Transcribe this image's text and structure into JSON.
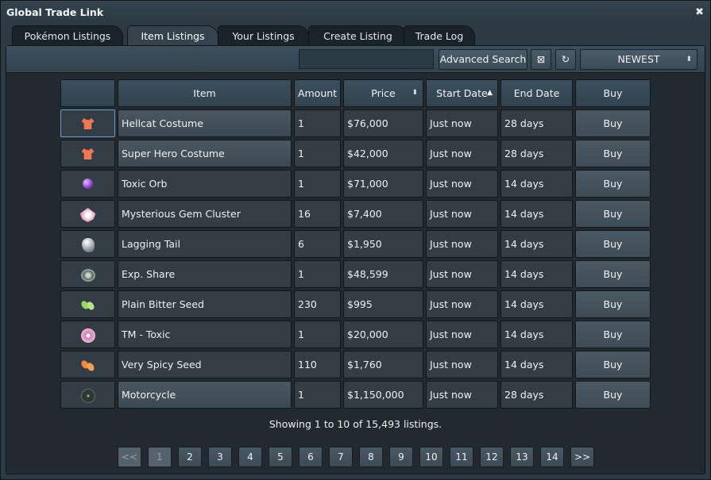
{
  "window": {
    "title": "Global Trade Link"
  },
  "tabs": [
    {
      "label": "Pokémon Listings"
    },
    {
      "label": "Item Listings"
    },
    {
      "label": "Your Listings"
    },
    {
      "label": "Create Listing"
    },
    {
      "label": "Trade Log"
    }
  ],
  "active_tab": "Item Listings",
  "toolbar": {
    "search_value": "",
    "advanced_search_label": "Advanced Search",
    "clear_icon": "⊠",
    "refresh_icon": "↻",
    "sort_value": "NEWEST",
    "sort_arrow": "⬍"
  },
  "table": {
    "headers": {
      "icon": "",
      "item": "Item",
      "amount": "Amount",
      "price": "Price",
      "start_date": "Start Date",
      "end_date": "End Date",
      "buy": "Buy"
    },
    "price_sort_icon": "⬍",
    "start_date_sort_icon": "▲",
    "rows": [
      {
        "icon": "costume-icon",
        "item": "Hellcat Costume",
        "amount": "1",
        "price": "$76,000",
        "start": "Just now",
        "end": "28 days",
        "buy": "Buy"
      },
      {
        "icon": "costume-icon",
        "item": "Super Hero Costume",
        "amount": "1",
        "price": "$42,000",
        "start": "Just now",
        "end": "28 days",
        "buy": "Buy"
      },
      {
        "icon": "orb-icon",
        "item": "Toxic Orb",
        "amount": "1",
        "price": "$71,000",
        "start": "Just now",
        "end": "14 days",
        "buy": "Buy"
      },
      {
        "icon": "gem-cluster-icon",
        "item": "Mysterious Gem Cluster",
        "amount": "16",
        "price": "$7,400",
        "start": "Just now",
        "end": "14 days",
        "buy": "Buy"
      },
      {
        "icon": "lagging-tail-icon",
        "item": "Lagging Tail",
        "amount": "6",
        "price": "$1,950",
        "start": "Just now",
        "end": "14 days",
        "buy": "Buy"
      },
      {
        "icon": "exp-share-icon",
        "item": "Exp. Share",
        "amount": "1",
        "price": "$48,599",
        "start": "Just now",
        "end": "14 days",
        "buy": "Buy"
      },
      {
        "icon": "seed-icon",
        "item": "Plain Bitter Seed",
        "amount": "230",
        "price": "$995",
        "start": "Just now",
        "end": "14 days",
        "buy": "Buy"
      },
      {
        "icon": "tm-disc-icon",
        "item": "TM - Toxic",
        "amount": "1",
        "price": "$20,000",
        "start": "Just now",
        "end": "14 days",
        "buy": "Buy"
      },
      {
        "icon": "seed-icon",
        "item": "Very Spicy Seed",
        "amount": "110",
        "price": "$1,760",
        "start": "Just now",
        "end": "14 days",
        "buy": "Buy"
      },
      {
        "icon": "motorcycle-icon",
        "item": "Motorcycle",
        "amount": "1",
        "price": "$1,150,000",
        "start": "Just now",
        "end": "28 days",
        "buy": "Buy"
      }
    ]
  },
  "status_text": "Showing 1 to 10 of 15,493 listings.",
  "pagination": {
    "first": "<<",
    "pages": [
      "1",
      "2",
      "3",
      "4",
      "5",
      "6",
      "7",
      "8",
      "9",
      "10",
      "11",
      "12",
      "13",
      "14"
    ],
    "current": "1",
    "next": ">>"
  },
  "colors": {
    "window_bg": "#2d3a44",
    "panel_bg": "#22292f",
    "cell_bg": "#323d46",
    "selected_border": "#6d9ccc",
    "costume": "#f07850",
    "orb": "#8b3dc7",
    "green_seed": "#9bd36a",
    "spicy_seed": "#f08a3a"
  }
}
